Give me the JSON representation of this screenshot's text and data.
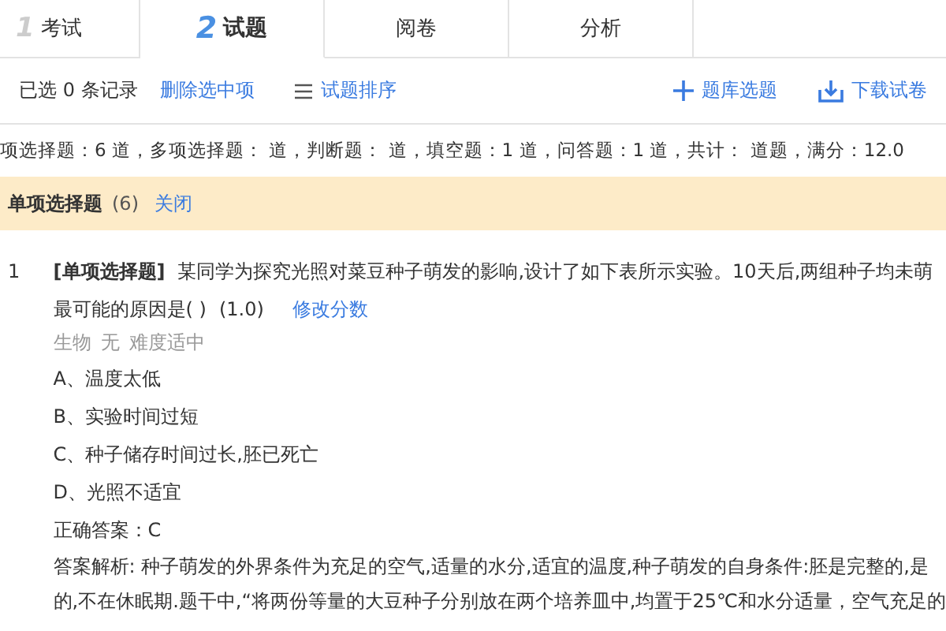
{
  "tabs": [
    {
      "number": "1",
      "label": "考试",
      "selected": false
    },
    {
      "number": "2",
      "label": "试题",
      "selected": true
    },
    {
      "label": "阅卷",
      "selected": false
    },
    {
      "label": "分析",
      "selected": false
    }
  ],
  "toolbar": {
    "selection_count": "已选 0 条记录",
    "delete_link": "删除选中项",
    "sort_link": "试题排序",
    "add_button": "题库选题",
    "download_button": "下载试卷"
  },
  "summary": "项选择题：6 道，多项选择题： 道，判断题： 道，填空题：1 道，问答题：1 道，共计： 道题，满分：12.0",
  "section": {
    "title": "单项选择题",
    "count": "(6)",
    "close_link": "关闭"
  },
  "questions": [
    {
      "number": "1",
      "stem": "**[单项选择题]** 某同学为探究光照对菜豆种子萌发的影响,设计了如下表所示实验。10天后,两组种子均未萌",
      "stem_end": "最可能的原因是( )",
      "score": "(1.0)",
      "edit_link": "修改分数",
      "subject": "生物",
      "knowledge": "无",
      "difficulty": "难度适中",
      "options": [
        "A、温度太低",
        "B、实验时间过短",
        "C、种子储存时间过长,胚已死亡",
        "D、光照不适宜"
      ],
      "answer": "正确答案：C",
      "explanation": [
        "答案解析: 种子萌发的外界条件为充足的空气,适量的水分,适宜的温度,种子萌发的自身条件:胚是完整的,是",
        "的,不在休眠期.题干中,“将两份等量的大豆种子分别放在两个培养皿中,均置于25℃和水分适量，空气充足的"
      ]
    }
  ]
}
